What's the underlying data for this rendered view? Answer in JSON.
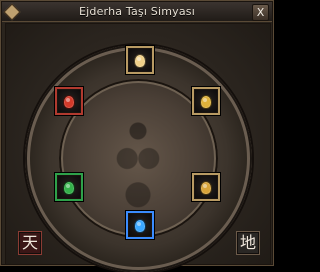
{
  "window": {
    "title": "Ejderha Taşı Simyası",
    "close_glyph": "X"
  },
  "slots": [
    {
      "name": "top",
      "gem_color": "#f0d08a"
    },
    {
      "name": "upper-left",
      "gem_color": "#d43a2a"
    },
    {
      "name": "upper-right",
      "gem_color": "#e0b23a"
    },
    {
      "name": "lower-left",
      "gem_color": "#35b14b"
    },
    {
      "name": "lower-right",
      "gem_color": "#d8a43a"
    },
    {
      "name": "bottom",
      "gem_color": "#3aa6ff"
    }
  ],
  "buttons": {
    "left_char": "天",
    "right_char": "地"
  },
  "colors": {
    "slot_border_gold": "#b89a63",
    "slot_border_red": "#b13a2f",
    "slot_border_green": "#2ea14a",
    "slot_border_blue": "#3a8cff"
  }
}
